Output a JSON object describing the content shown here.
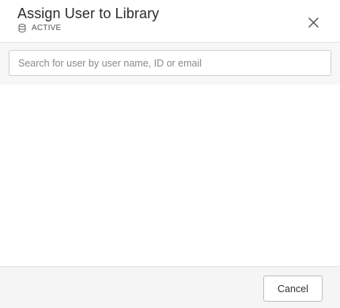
{
  "dialog": {
    "title": "Assign User to Library",
    "status": {
      "icon": "database-icon",
      "label": "ACTIVE"
    },
    "close_icon": "close-icon"
  },
  "search": {
    "value": "",
    "placeholder": "Search for user by user name, ID or email"
  },
  "footer": {
    "cancel_label": "Cancel"
  }
}
